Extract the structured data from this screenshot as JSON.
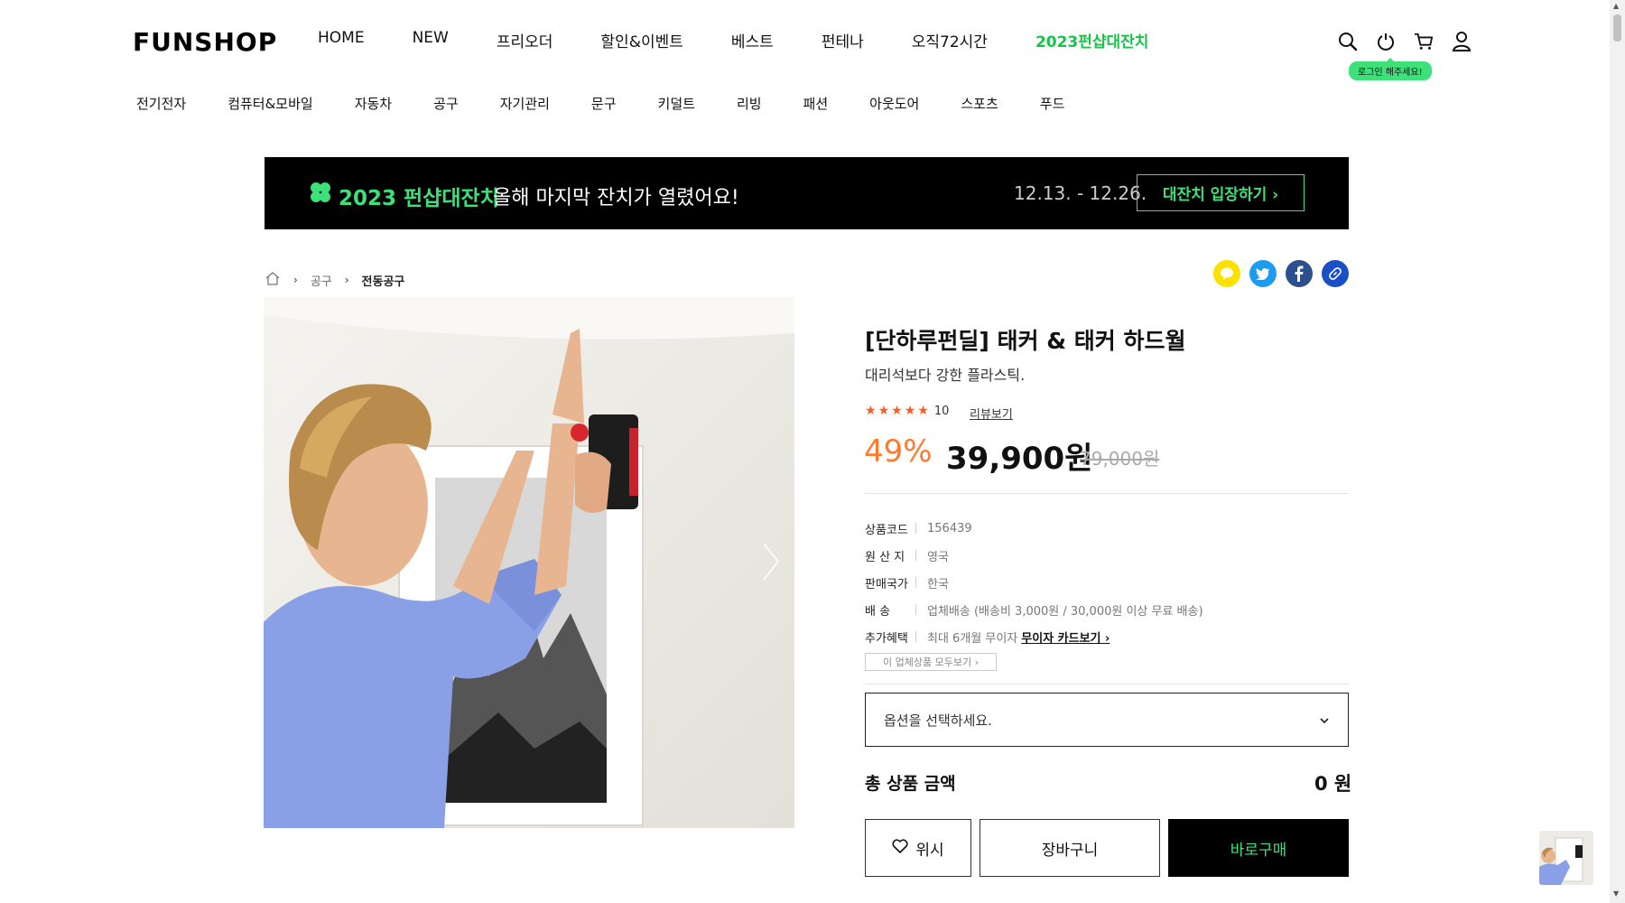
{
  "header": {
    "logo": "FUNSHOP",
    "gnb": [
      "HOME",
      "NEW",
      "프리오더",
      "할인&이벤트",
      "베스트",
      "펀테나",
      "오직72시간",
      "2023펀샵대잔치"
    ],
    "login_tip": "로그인 해주세요!",
    "icons": [
      "search-icon",
      "power-icon",
      "cart-icon",
      "user-icon"
    ]
  },
  "categories": [
    "전기전자",
    "컴퓨터&모바일",
    "자동차",
    "공구",
    "자기관리",
    "문구",
    "키덜트",
    "리빙",
    "패션",
    "아웃도어",
    "스포츠",
    "푸드"
  ],
  "banner": {
    "highlight": "2023 펀샵대잔치",
    "text": "올해 마지막 잔치가 열렸어요!",
    "date": "12.13. - 12.26.",
    "button": "대잔치 입장하기 ›"
  },
  "breadcrumb": {
    "items": [
      "공구",
      "전동공구"
    ]
  },
  "product": {
    "title": "[단하루펀딜] 태커 & 태커 하드월",
    "subtitle": "대리석보다 강한 플라스틱.",
    "rating_count": "10",
    "review_link": "리뷰보기",
    "discount": "49%",
    "price": "39,900원",
    "original_price": "79,000원",
    "specs": [
      {
        "key": "상품코드",
        "value": "156439"
      },
      {
        "key": "원 산 지",
        "value": "영국"
      },
      {
        "key": "판매국가",
        "value": "한국"
      },
      {
        "key": "배 송",
        "value": "업체배송 (배송비 3,000원 / 30,000원 이상 무료 배송)"
      },
      {
        "key": "추가혜택",
        "value": "최대 6개월 무이자",
        "link": "무이자 카드보기 ›"
      }
    ],
    "seller_button": "이 업체상품 모두보기 ›",
    "option_placeholder": "옵션을 선택하세요.",
    "total_label": "총 상품 금액",
    "total_value": "0 원",
    "wish_button": "위시",
    "cart_button": "장바구니",
    "buy_button": "바로구매"
  },
  "colors": {
    "accent": "#3ee07a",
    "discount": "#ff7a2e",
    "star": "#ff5a1f"
  }
}
